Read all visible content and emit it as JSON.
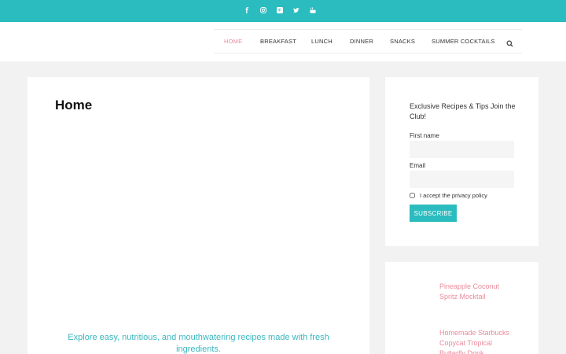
{
  "social": {
    "icons": [
      "facebook-icon",
      "instagram-icon",
      "pinterest-icon",
      "twitter-icon",
      "youtube-icon"
    ],
    "color": "#ffffff"
  },
  "nav": {
    "items": [
      {
        "label": "HOME",
        "active": true
      },
      {
        "label": "BREAKFAST",
        "active": false
      },
      {
        "label": "LUNCH",
        "active": false
      },
      {
        "label": "DINNER",
        "active": false
      },
      {
        "label": "SNACKS",
        "active": false
      },
      {
        "label": "SUMMER COCKTAILS",
        "active": false
      }
    ],
    "search_icon": "search-icon"
  },
  "main": {
    "title": "Home",
    "tagline": "Explore easy, nutritious, and mouthwatering recipes made with fresh ingredients."
  },
  "newsletter": {
    "title": "Exclusive Recipes & Tips Join the Club!",
    "first_name_label": "First name",
    "first_name_value": "",
    "email_label": "Email",
    "email_value": "",
    "privacy_label": "I accept the privacy policy",
    "privacy_checked": false,
    "subscribe_label": "SUBSCRIBE"
  },
  "recent_posts": [
    {
      "title": "Pineapple Coconut Spritz Mocktail"
    },
    {
      "title": "Homemade Starbucks Copycat Tropical Butterfly Drink"
    }
  ],
  "colors": {
    "accent": "#2bbcbf",
    "link": "#e98c9c",
    "background": "#f2f2f2"
  }
}
